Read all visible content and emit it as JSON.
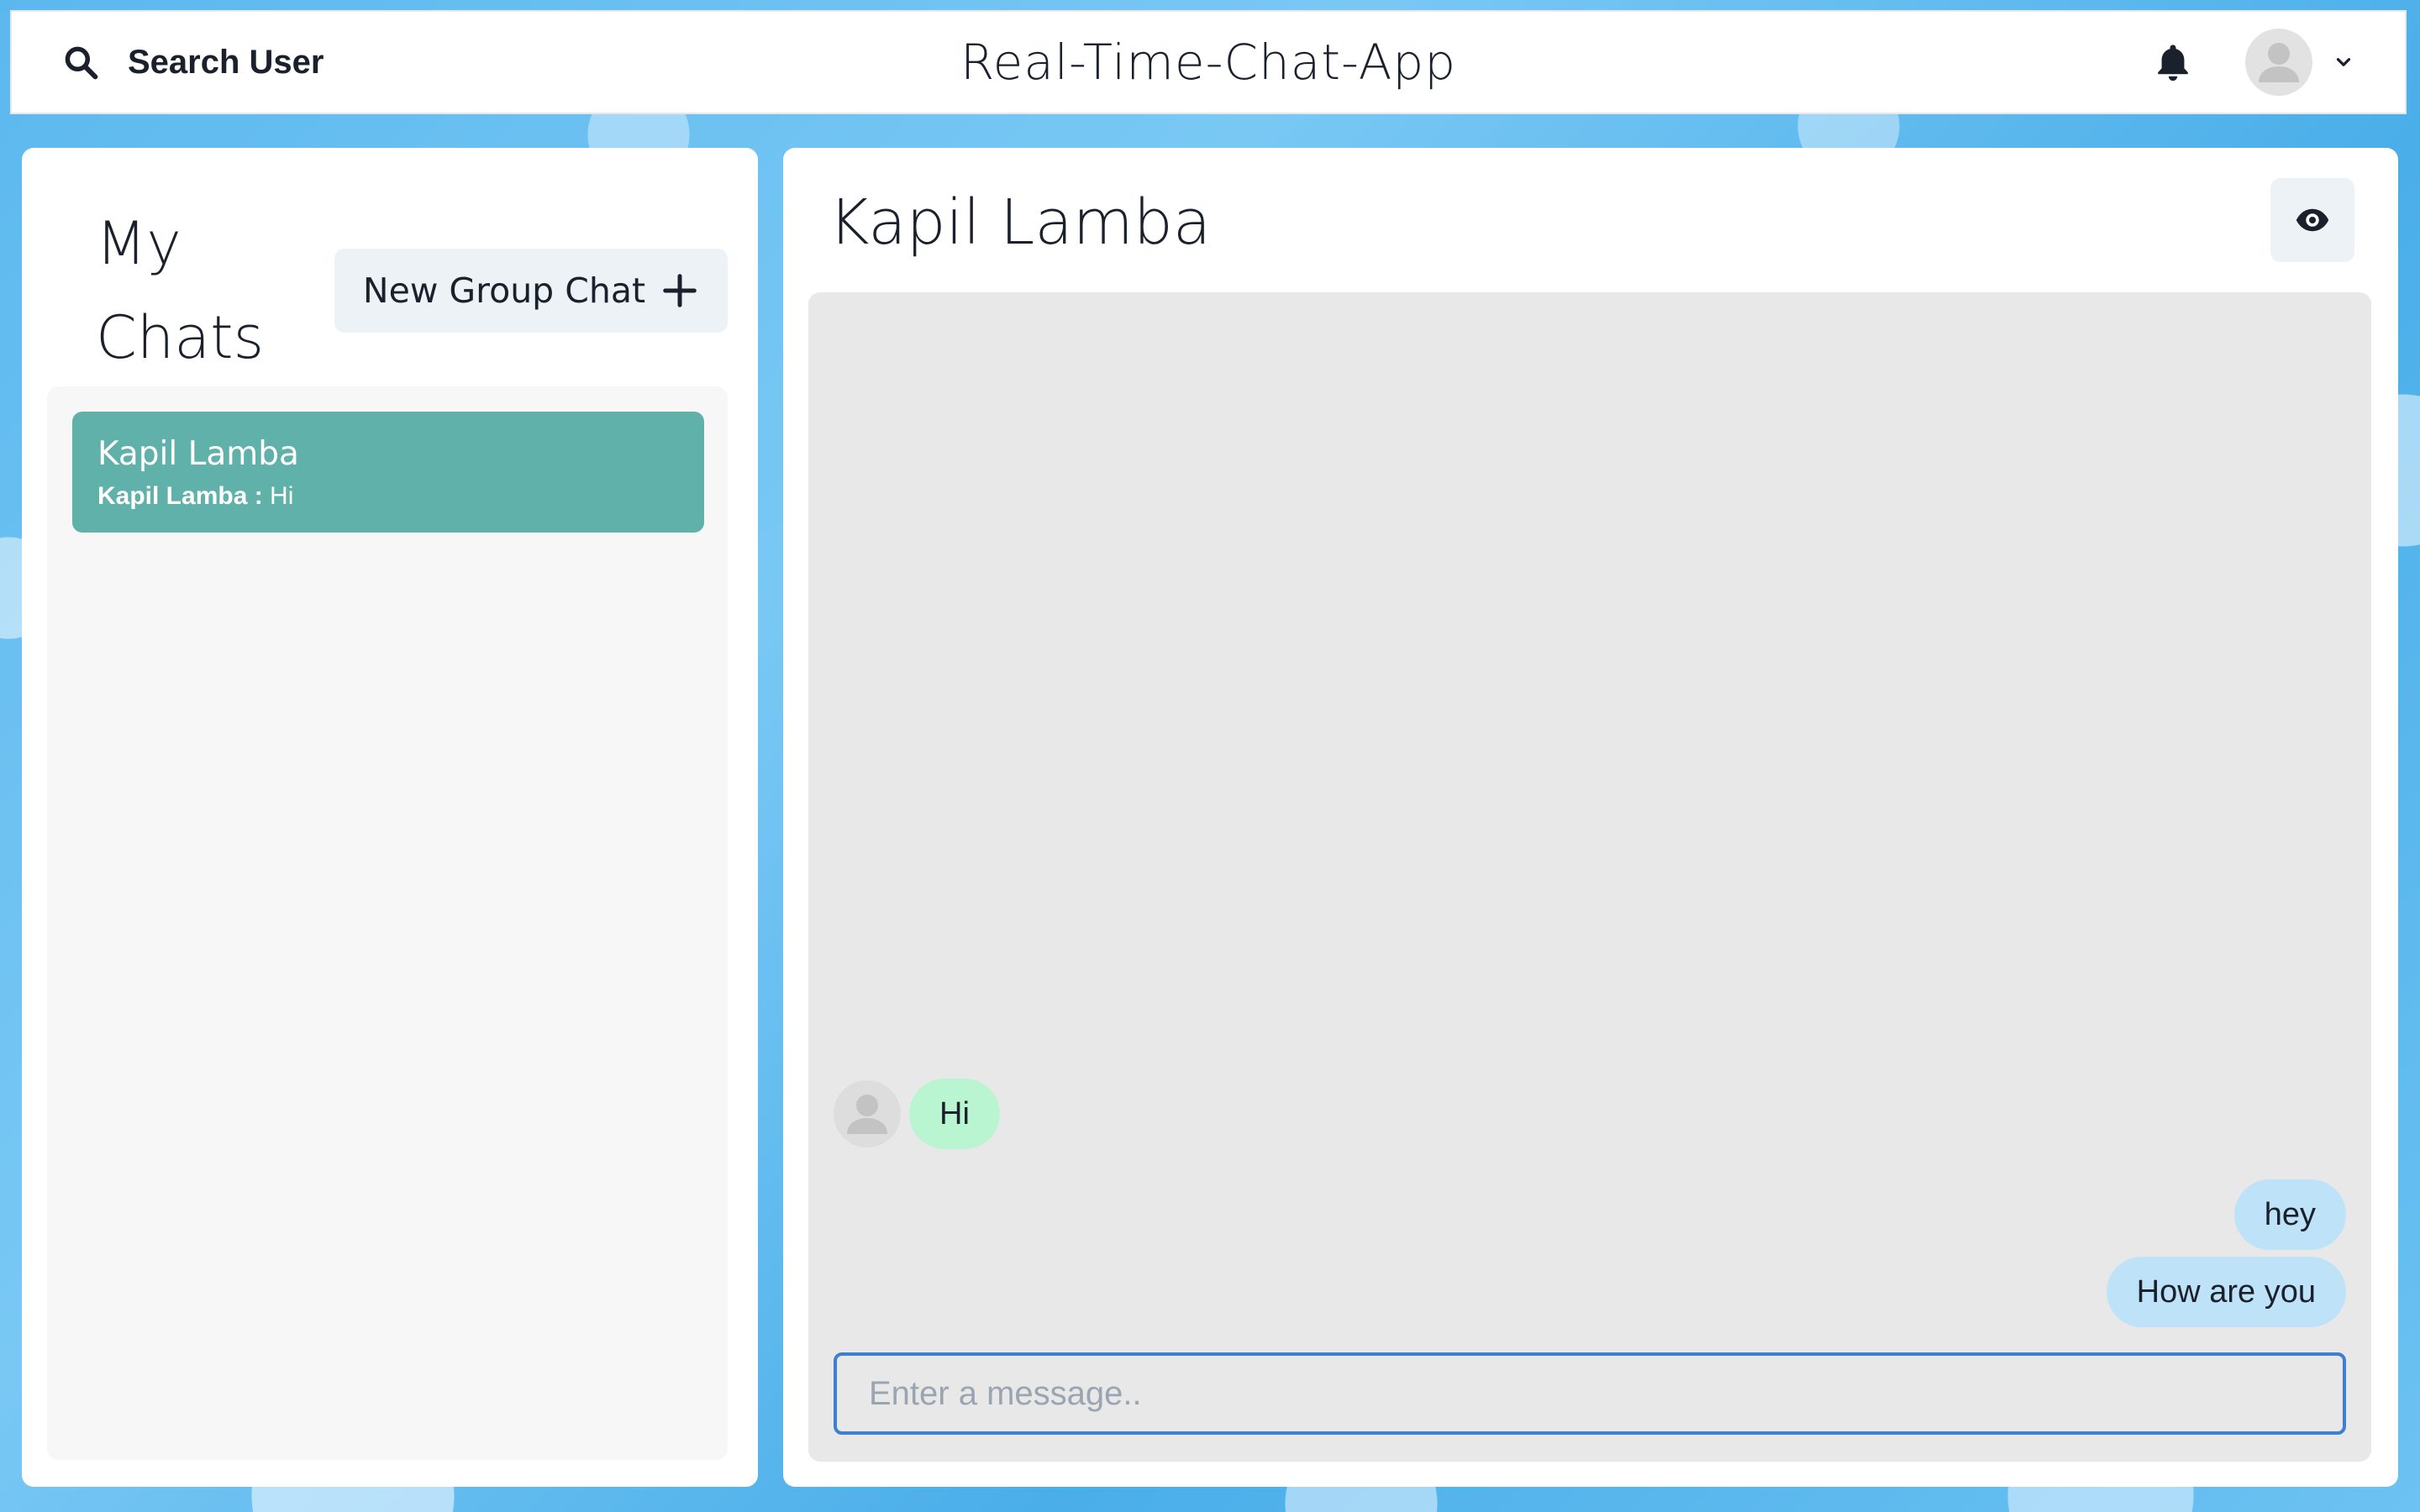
{
  "header": {
    "search_label": "Search User",
    "app_title": "Real-Time-Chat-App"
  },
  "sidebar": {
    "title": "My Chats",
    "new_group_label": "New Group Chat",
    "chats": [
      {
        "name": "Kapil Lamba",
        "latest_sender": "Kapil Lamba :",
        "latest_message": " Hi"
      }
    ]
  },
  "chat": {
    "title": "Kapil Lamba",
    "messages": [
      {
        "text": "Hi",
        "direction": "received"
      },
      {
        "text": "hey",
        "direction": "sent"
      },
      {
        "text": "How are you",
        "direction": "sent"
      }
    ],
    "input_placeholder": "Enter a message.."
  },
  "colors": {
    "selected_chat": "#5fb1aa",
    "received_bubble": "#b9f5d0",
    "sent_bubble": "#bee3f8",
    "input_focus_border": "#3d7fd1"
  }
}
